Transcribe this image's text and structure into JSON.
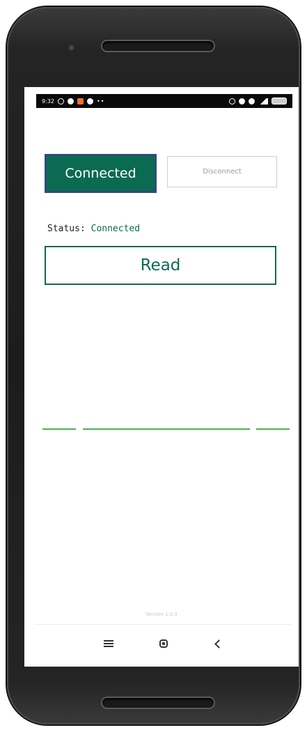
{
  "status_bar": {
    "time": "9:32",
    "dots": "••"
  },
  "connection": {
    "connected_label": "Connected",
    "disconnect_label": "Disconnect"
  },
  "status": {
    "label": "Status:",
    "value": "Connected"
  },
  "read_button": {
    "label": "Read"
  },
  "footer": {
    "version": "Version 1.0.3"
  },
  "colors": {
    "primary": "#0b6a52",
    "accent_border": "#2f4a7a",
    "divider_green": "#4caf50"
  },
  "icons": {
    "nav_menu": "recent-apps-icon",
    "nav_home": "home-icon",
    "nav_back": "back-icon"
  }
}
